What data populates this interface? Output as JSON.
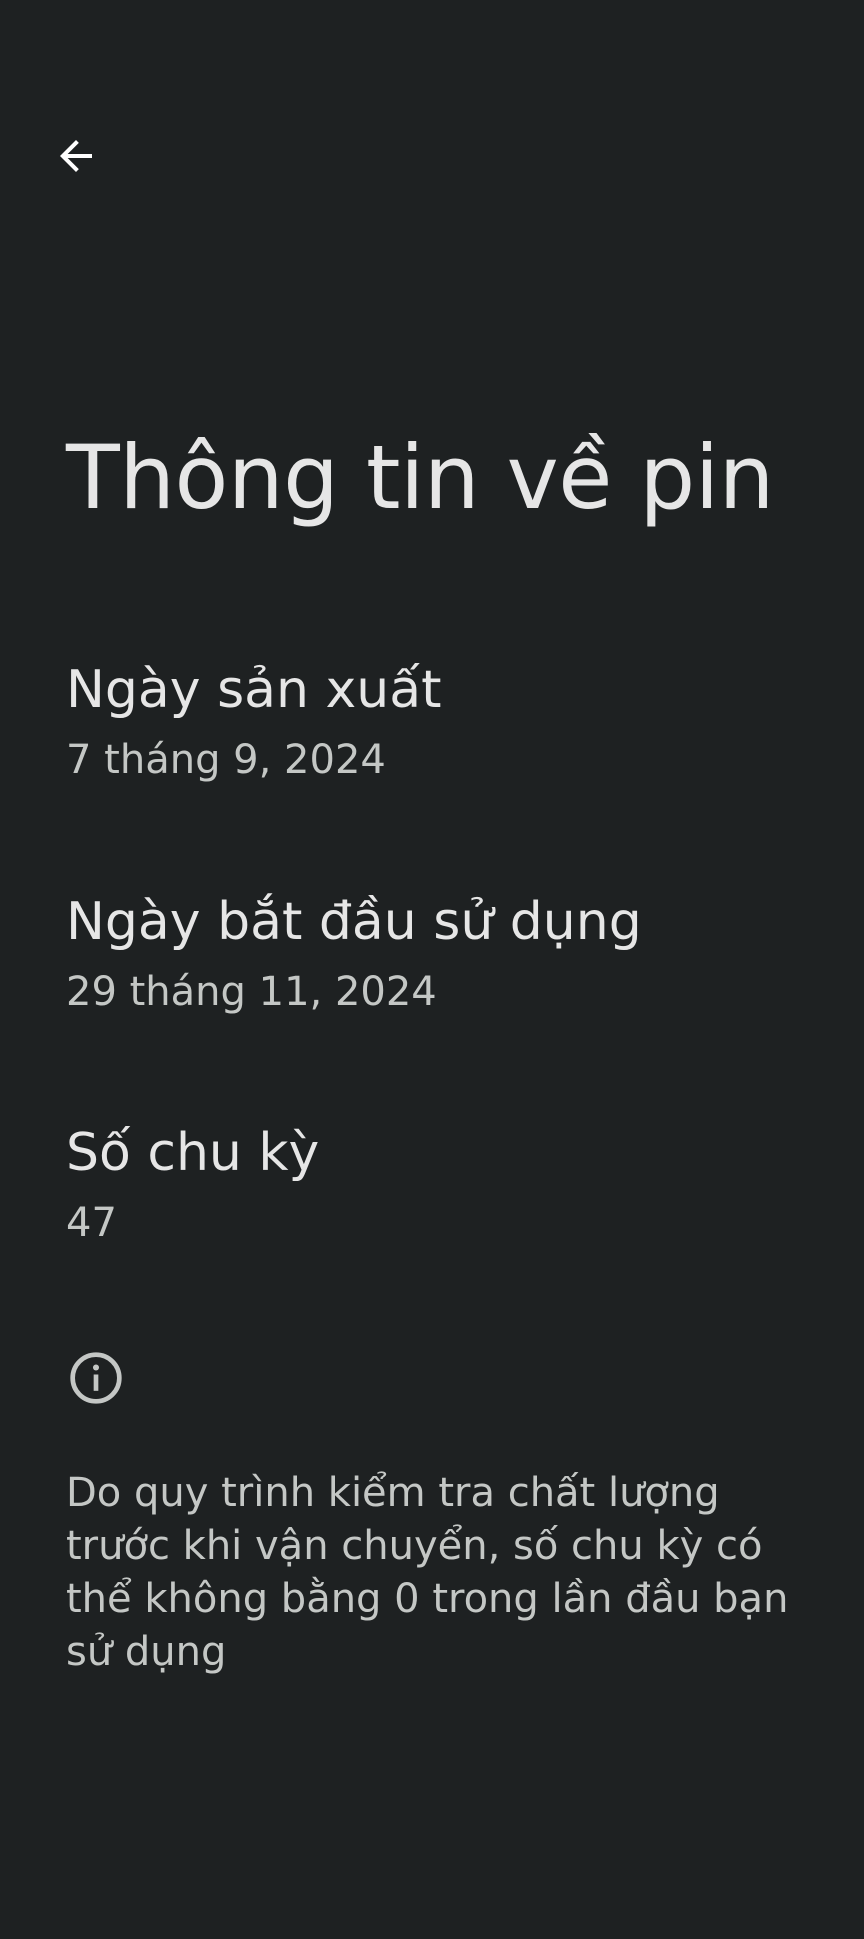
{
  "header": {
    "back_icon": "arrow-back-icon"
  },
  "page": {
    "title": "Thông tin về pin"
  },
  "items": [
    {
      "title": "Ngày sản xuất",
      "summary": "7 tháng 9, 2024"
    },
    {
      "title": "Ngày bắt đầu sử dụng",
      "summary": "29 tháng 11, 2024"
    },
    {
      "title": "Số chu kỳ",
      "summary": "47"
    }
  ],
  "footer": {
    "icon": "info-icon",
    "text": "Do quy trình kiểm tra chất lượng trước khi vận chuyển, số chu kỳ có thể không bằng 0 trong lần đầu bạn sử dụng"
  },
  "colors": {
    "background": "#1e2122",
    "title_text": "#e6e6e6",
    "summary_text": "#c4c7c5"
  }
}
